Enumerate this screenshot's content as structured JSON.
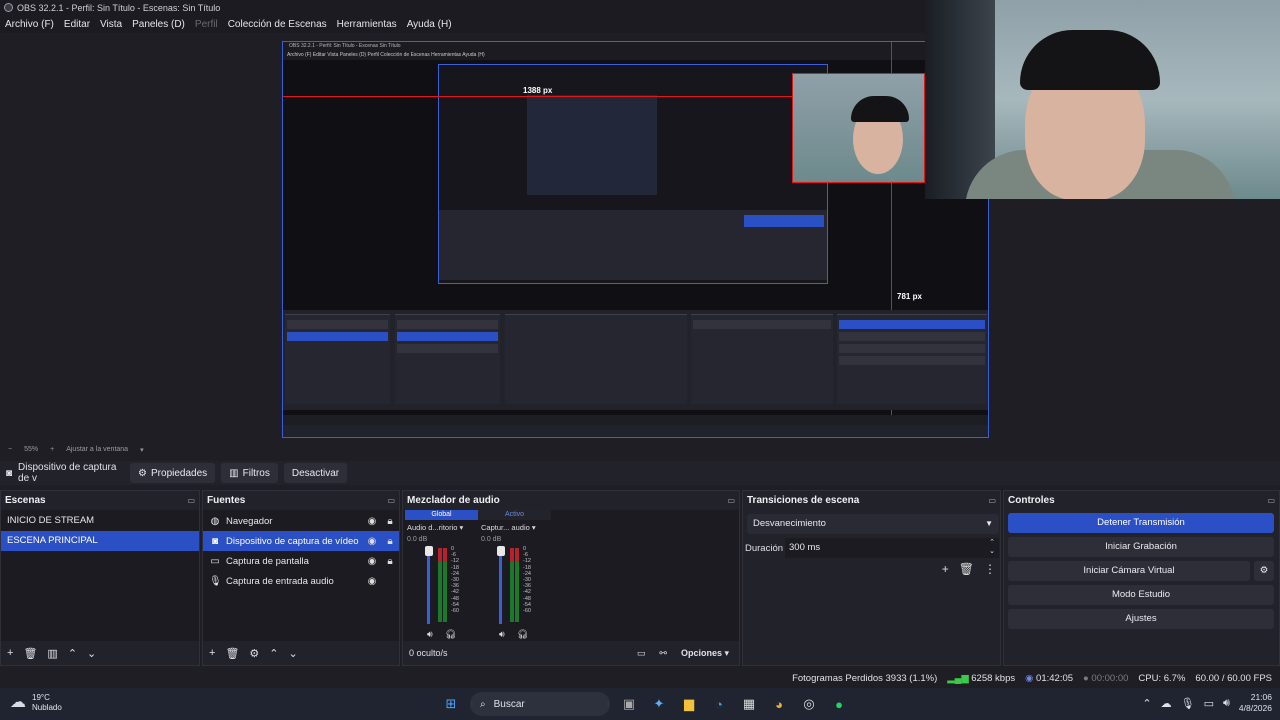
{
  "window": {
    "title": "OBS 32.2.1 - Perfil: Sin Título - Escenas: Sin Título"
  },
  "menu": [
    "Archivo (F)",
    "Editar",
    "Vista",
    "Paneles (D)",
    "Perfil",
    "Colección de Escenas",
    "Herramientas",
    "Ayuda (H)"
  ],
  "preview": {
    "label_width": "1388 px",
    "label_height": "781 px",
    "zoom": "55%",
    "fit": "Ajustar a la ventana",
    "nested_title": "OBS 32.2.1 - Perfil: Sin Título - Escenas Sin Título",
    "nested_menu": "Archivo (F)   Editar   Vista   Paneles (D)   Perfil   Colección de Escenas   Herramientas   Ayuda (H)"
  },
  "source_toolbar": {
    "current_source": "Dispositivo de captura de v",
    "properties": "Propiedades",
    "filters": "Filtros",
    "deactivate": "Desactivar"
  },
  "scenes": {
    "title": "Escenas",
    "items": [
      "INICIO DE STREAM",
      "ESCENA PRINCIPAL"
    ]
  },
  "sources": {
    "title": "Fuentes",
    "items": [
      {
        "label": "Navegador",
        "icon": "globe-icon"
      },
      {
        "label": "Dispositivo de captura de vídeo",
        "icon": "camera-icon"
      },
      {
        "label": "Captura de pantalla",
        "icon": "monitor-icon"
      },
      {
        "label": "Captura de entrada audio",
        "icon": "microphone-icon"
      }
    ]
  },
  "mixer": {
    "title": "Mezclador de audio",
    "tab_global": "Global",
    "tab_active": "Activo",
    "channels": [
      {
        "name": "Audio d...ritorio",
        "db": "0.0 dB"
      },
      {
        "name": "Captur... audio",
        "db": "0.0 dB"
      }
    ],
    "scale": [
      "0",
      "-6",
      "-12",
      "-18",
      "-24",
      "-30",
      "-36",
      "-42",
      "-48",
      "-54",
      "-60"
    ],
    "hidden": "0 oculto/s",
    "options": "Opciones"
  },
  "transitions": {
    "title": "Transiciones de escena",
    "selected": "Desvanecimiento",
    "duration_label": "Duración",
    "duration_value": "300 ms"
  },
  "controls": {
    "title": "Controles",
    "stop_stream": "Detener Transmisión",
    "start_record": "Iniciar Grabación",
    "virtual_cam": "Iniciar Cámara Virtual",
    "studio_mode": "Modo Estudio",
    "settings": "Ajustes"
  },
  "status": {
    "dropped_frames": "Fotogramas Perdidos 3933 (1.1%)",
    "bitrate": "6258 kbps",
    "stream_time": "01:42:05",
    "record_time": "00:00:00",
    "cpu": "CPU: 6.7%",
    "fps": "60.00 / 60.00 FPS"
  },
  "taskbar": {
    "temperature": "19°C",
    "weather": "Nublado",
    "search": "Buscar",
    "time": "21:06",
    "date": "4/8/2026"
  },
  "colors": {
    "accent": "#2b4fc4",
    "guide_red": "#e01818",
    "meter_green": "#1a7a2a"
  }
}
